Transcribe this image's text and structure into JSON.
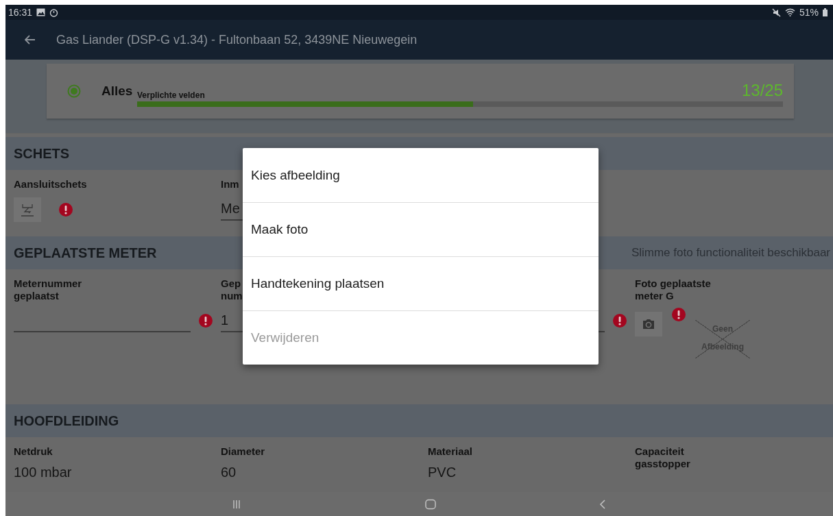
{
  "status_bar": {
    "time": "16:31",
    "battery": "51%"
  },
  "app_bar": {
    "title": "Gas Liander (DSP-G v1.34) - Fultonbaan 52, 3439NE Nieuwegein"
  },
  "progress": {
    "label": "Alles",
    "selected": true,
    "caption": "Verplichte velden",
    "level": 0.52,
    "count": "13/25"
  },
  "sections": [
    {
      "title": "SCHETS",
      "fields": [
        {
          "kind": "sketch",
          "label": "Aansluitschets",
          "error": true
        },
        {
          "kind": "text",
          "label": "Inm",
          "value": "Me",
          "error": false
        }
      ]
    },
    {
      "title": "GEPLAATSTE METER",
      "note": "Slimme foto functionaliteit beschikbaar",
      "fields": [
        {
          "kind": "text",
          "label": "Meternummer\ngeplaatst",
          "error": true
        },
        {
          "kind": "text",
          "label": "Gep\nnum",
          "value": "1",
          "error": false
        },
        {
          "kind": "text",
          "error": true
        },
        {
          "kind": "photo",
          "label": "Foto geplaatste\nmeter G",
          "error": true,
          "placeholder": "Geen\nAfbeelding"
        }
      ]
    },
    {
      "title": "HOOFDLEIDING",
      "fields": [
        {
          "kind": "value",
          "label": "Netdruk",
          "value": "100 mbar"
        },
        {
          "kind": "value",
          "label": "Diameter",
          "value": "60"
        },
        {
          "kind": "value",
          "label": "Materiaal",
          "value": "PVC"
        },
        {
          "kind": "value",
          "label": "Capaciteit\ngasstopper"
        }
      ]
    }
  ],
  "dialog": {
    "items": [
      {
        "label": "Kies afbeelding",
        "disabled": false
      },
      {
        "label": "Maak foto",
        "disabled": false
      },
      {
        "label": "Handtekening plaatsen",
        "disabled": false
      },
      {
        "label": "Verwijderen",
        "disabled": true
      }
    ]
  }
}
